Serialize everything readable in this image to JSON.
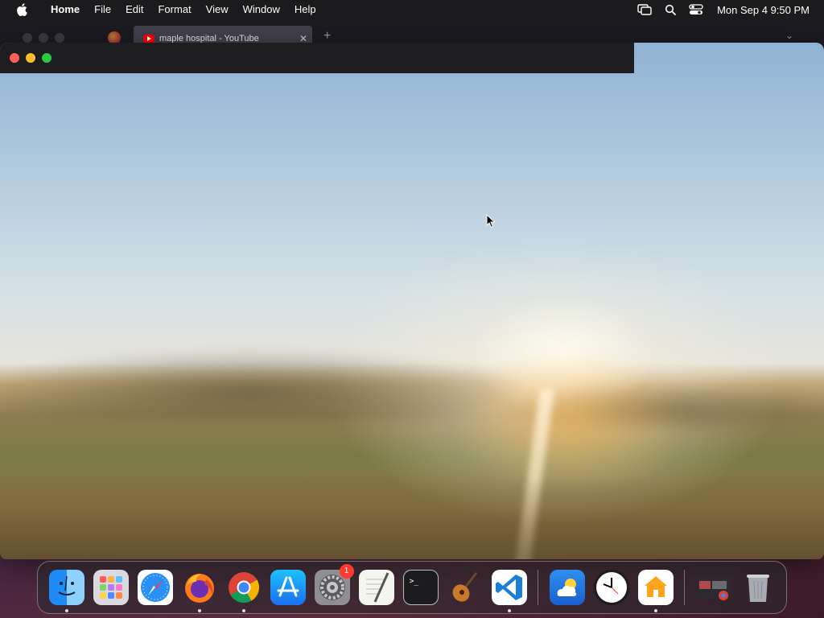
{
  "menubar": {
    "app_name": "Home",
    "items": [
      "File",
      "Edit",
      "Format",
      "View",
      "Window",
      "Help"
    ],
    "clock": "Mon Sep 4  9:50 PM"
  },
  "background_browser": {
    "tab_title": "maple hospital - YouTube",
    "close_glyph": "✕",
    "new_tab_glyph": "+",
    "chevron_glyph": "⌄"
  },
  "dock": {
    "items": [
      {
        "name": "Finder",
        "icon": "finder-icon",
        "running": true
      },
      {
        "name": "Launchpad",
        "icon": "launchpad-icon",
        "running": false
      },
      {
        "name": "Safari",
        "icon": "safari-icon",
        "running": false
      },
      {
        "name": "Firefox",
        "icon": "firefox-icon",
        "running": true
      },
      {
        "name": "Google Chrome",
        "icon": "chrome-icon",
        "running": true
      },
      {
        "name": "App Store",
        "icon": "app-store-icon",
        "running": false
      },
      {
        "name": "System Settings",
        "icon": "settings-icon",
        "running": false,
        "badge": "1"
      },
      {
        "name": "TextEdit",
        "icon": "textedit-icon",
        "running": false
      },
      {
        "name": "Terminal",
        "icon": "terminal-icon",
        "running": false
      },
      {
        "name": "GarageBand",
        "icon": "guitar-icon",
        "running": false
      },
      {
        "name": "Visual Studio Code",
        "icon": "vscode-icon",
        "running": true
      },
      {
        "name": "Weather",
        "icon": "weather-icon",
        "running": false
      },
      {
        "name": "Clock",
        "icon": "clock-icon",
        "running": false
      },
      {
        "name": "Home",
        "icon": "home-icon",
        "running": true
      },
      {
        "name": "Downloads",
        "icon": "downloads-stack-icon",
        "running": false
      },
      {
        "name": "Trash",
        "icon": "trash-icon",
        "running": false
      }
    ]
  }
}
